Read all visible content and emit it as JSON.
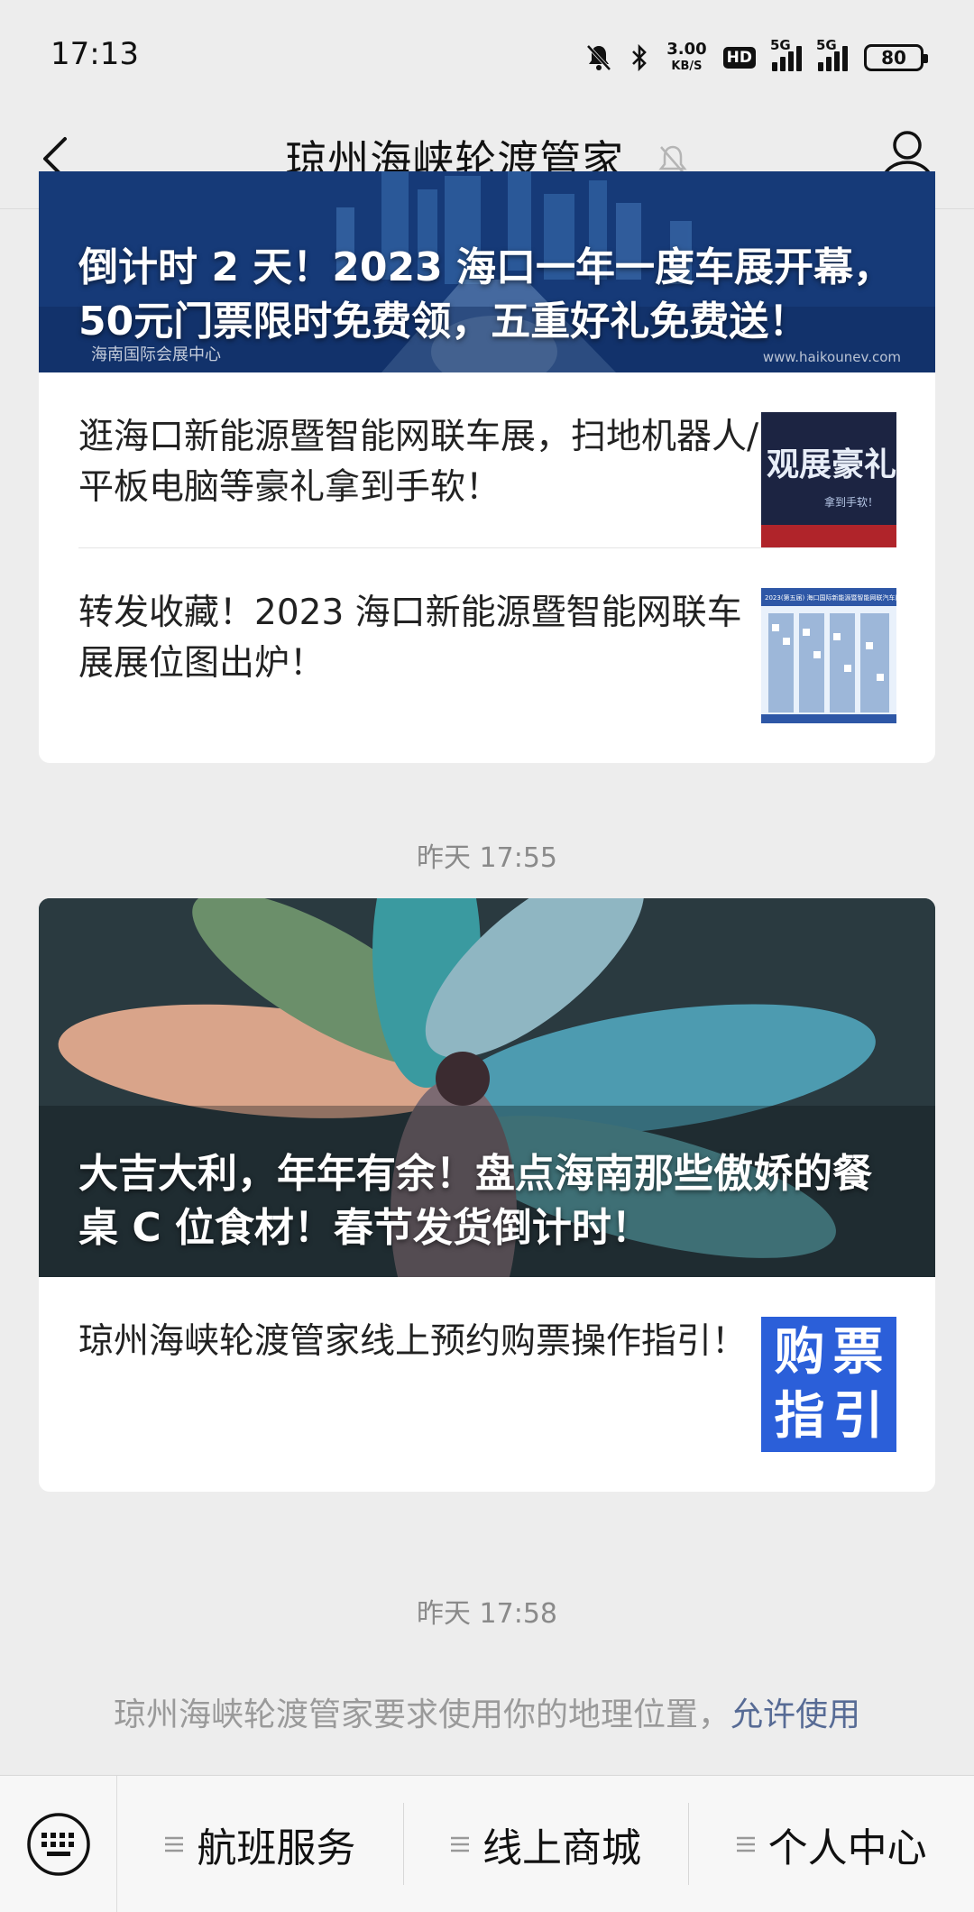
{
  "status_bar": {
    "time": "17:13",
    "net_speed_value": "3.00",
    "net_speed_unit": "KB/S",
    "hd_label": "HD",
    "signal_1_tag": "5G",
    "signal_2_tag": "5G",
    "battery": "80"
  },
  "nav": {
    "title": "琼州海峡轮渡管家"
  },
  "group1": {
    "banner_title": "倒计时 2 天！2023 海口一年一度车展开幕，50元门票限时免费领，五重好礼免费送！",
    "banner_watermark_left": "海南国际会展中心",
    "banner_watermark_right": "www.haikounev.com",
    "articles": [
      {
        "title": "逛海口新能源暨智能网联车展，扫地机器人/平板电脑等豪礼拿到手软！",
        "thumb_text": "观展豪礼",
        "thumb_sub": "拿到手软！"
      },
      {
        "title": "转发收藏！2023 海口新能源暨智能网联车展展位图出炉！",
        "thumb_text": "2023(第五届) 海口国际新能源暨智能网联汽车展"
      }
    ]
  },
  "timestamp1": "昨天 17:55",
  "group2": {
    "banner_title": "大吉大利，年年有余！盘点海南那些傲娇的餐桌 C 位食材！春节发货倒计时！",
    "articles": [
      {
        "title": "琼州海峡轮渡管家线上预约购票操作指引！",
        "thumb_chars": [
          "购",
          "票",
          "指",
          "引"
        ]
      }
    ]
  },
  "timestamp2": "昨天 17:58",
  "location_prompt": {
    "text": "琼州海峡轮渡管家要求使用你的地理位置，",
    "allow": "允许使用"
  },
  "menu": {
    "items": [
      "航班服务",
      "线上商城",
      "个人中心"
    ]
  },
  "colors": {
    "background": "#ededed",
    "link": "#576b95",
    "thumb_blue": "#2b5fd9"
  }
}
